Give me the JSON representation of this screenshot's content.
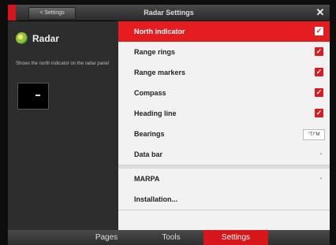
{
  "window": {
    "title": "Radar Settings",
    "back_label": "< Settings",
    "close_glyph": "✕"
  },
  "left_panel": {
    "title": "Radar",
    "icon": "radar-icon",
    "description": "Shows the north indicator on the radar panel"
  },
  "settings": {
    "items": [
      {
        "label": "North indicator",
        "control": "checkbox",
        "checked": true,
        "selected": true
      },
      {
        "label": "Range rings",
        "control": "checkbox",
        "checked": true
      },
      {
        "label": "Range markers",
        "control": "checkbox",
        "checked": true
      },
      {
        "label": "Compass",
        "control": "checkbox",
        "checked": true
      },
      {
        "label": "Heading line",
        "control": "checkbox",
        "checked": true
      },
      {
        "label": "Bearings",
        "control": "spinner",
        "value": "°T/°M"
      },
      {
        "label": "Data bar",
        "control": "submenu",
        "arrow": "›"
      },
      {
        "label": "MARPA",
        "control": "submenu",
        "arrow": "›"
      },
      {
        "label": "Installation...",
        "control": "none"
      }
    ],
    "check_glyph": "✓"
  },
  "tabs": [
    {
      "label": "Pages",
      "active": false
    },
    {
      "label": "Tools",
      "active": false
    },
    {
      "label": "Settings",
      "active": true
    }
  ],
  "colors": {
    "accent_red": "#e51d20",
    "list_bg": "#f2f2f2",
    "panel_bg": "#2d2d2d"
  }
}
